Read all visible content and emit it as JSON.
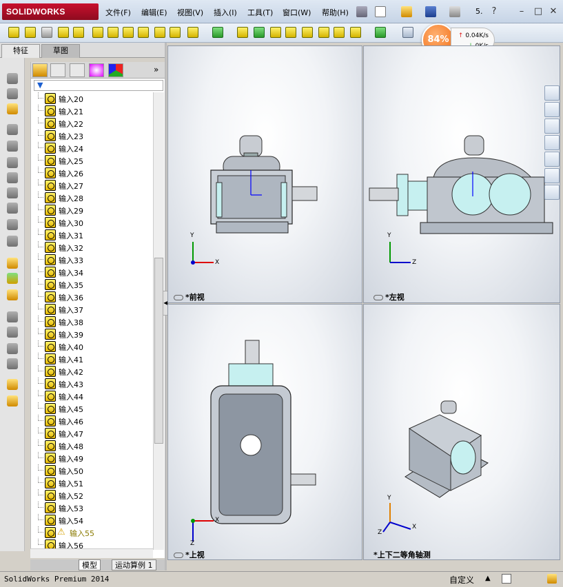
{
  "app": {
    "logo_text": "SOLIDWORKS",
    "menus": [
      "文件(F)",
      "编辑(E)",
      "视图(V)",
      "插入(I)",
      "工具(T)",
      "窗口(W)",
      "帮助(H)"
    ],
    "title_suffix": "5."
  },
  "perf": {
    "percent": "84%",
    "up": "0.04K/s",
    "down": "0K/s"
  },
  "panel_tabs": [
    "特征",
    "草图"
  ],
  "tree_items": [
    "输入20",
    "输入21",
    "输入22",
    "输入23",
    "输入24",
    "输入25",
    "输入26",
    "输入27",
    "输入28",
    "输入29",
    "输入30",
    "输入31",
    "输入32",
    "输入33",
    "输入34",
    "输入35",
    "输入36",
    "输入37",
    "输入38",
    "输入39",
    "输入40",
    "输入41",
    "输入42",
    "输入43",
    "输入44",
    "输入45",
    "输入46",
    "输入47",
    "输入48",
    "输入49",
    "输入50",
    "输入51",
    "输入52",
    "输入53",
    "输入54",
    "输入55",
    "输入56"
  ],
  "warning_item": "输入55",
  "bottom_tabs": [
    "模型",
    "运动算例 1"
  ],
  "views": {
    "front": "*前视",
    "left": "*左视",
    "top": "*上视",
    "iso": "*上下二等角轴测"
  },
  "axis": {
    "x": "X",
    "y": "Y",
    "z": "Z"
  },
  "status": {
    "product": "SolidWorks Premium 2014",
    "mode": "自定义"
  },
  "colors": {
    "accent": "#c8102e",
    "badge": "#f06a10"
  }
}
